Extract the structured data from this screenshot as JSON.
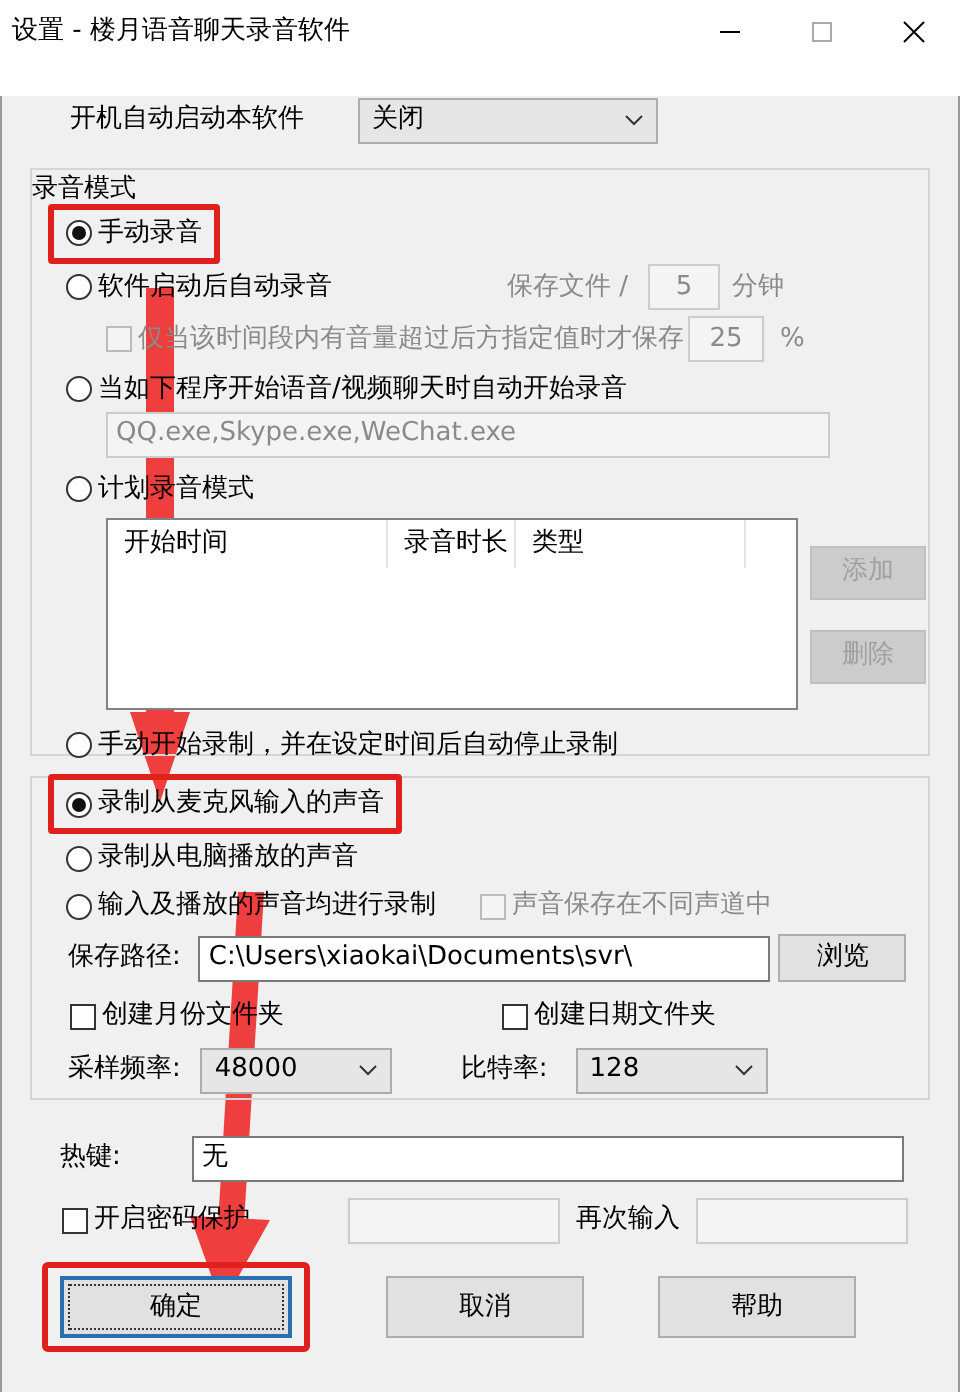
{
  "window": {
    "title": "设置 - 楼月语音聊天录音软件"
  },
  "autostart": {
    "label": "开机自动启动本软件",
    "value": "关闭"
  },
  "mode_group": {
    "legend": "录音模式",
    "manual": {
      "label": "手动录音",
      "selected": true,
      "highlighted": true
    },
    "auto_start": {
      "label": "软件启动后自动录音",
      "selected": false,
      "save_label": "保存文件 /",
      "save_value": "5",
      "save_unit": "分钟",
      "save_disabled": true
    },
    "threshold": {
      "label": "仅当该时间段内有音量超过后方指定值时才保存",
      "checked": false,
      "disabled": true,
      "value": "25",
      "unit": "%"
    },
    "on_chat": {
      "label": "当如下程序开始语音/视频聊天时自动开始录音",
      "selected": false,
      "programs": "QQ.exe,Skype.exe,WeChat.exe",
      "programs_disabled": true
    },
    "scheduled": {
      "label": "计划录音模式",
      "selected": false,
      "columns": [
        "开始时间",
        "录音时长",
        "类型"
      ],
      "buttons": [
        {
          "label": "添加",
          "disabled": true
        },
        {
          "label": "删除",
          "disabled": true
        }
      ]
    },
    "timed": {
      "label": "手动开始录制，并在设定时间后自动停止录制",
      "selected": false
    }
  },
  "source_group": {
    "options": [
      {
        "label": "录制从麦克风输入的声音",
        "selected": true,
        "highlighted": true
      },
      {
        "label": "录制从电脑播放的声音",
        "selected": false,
        "highlighted": false
      },
      {
        "label": "输入及播放的声音均进行录制",
        "selected": false,
        "highlighted": false
      }
    ],
    "separate_channels": {
      "label": "声音保存在不同声道中",
      "checked": false,
      "disabled": true
    },
    "path": {
      "label": "保存路径:",
      "value": "C:\\Users\\xiaokai\\Documents\\svr\\",
      "button": "浏览"
    },
    "folders": [
      {
        "label": "创建月份文件夹",
        "checked": false
      },
      {
        "label": "创建日期文件夹",
        "checked": false
      }
    ],
    "sample_rate": {
      "label": "采样频率:",
      "value": "48000"
    },
    "bitrate": {
      "label": "比特率:",
      "value": "128"
    }
  },
  "hotkey": {
    "label": "热键:",
    "value": "无"
  },
  "password": {
    "label": "开启密码保护",
    "checked": false,
    "confirm_label": "再次输入"
  },
  "buttons": [
    {
      "label": "确定",
      "focused": true,
      "highlighted": true
    },
    {
      "label": "取消",
      "focused": false,
      "highlighted": false
    },
    {
      "label": "帮助",
      "focused": false,
      "highlighted": false
    }
  ]
}
